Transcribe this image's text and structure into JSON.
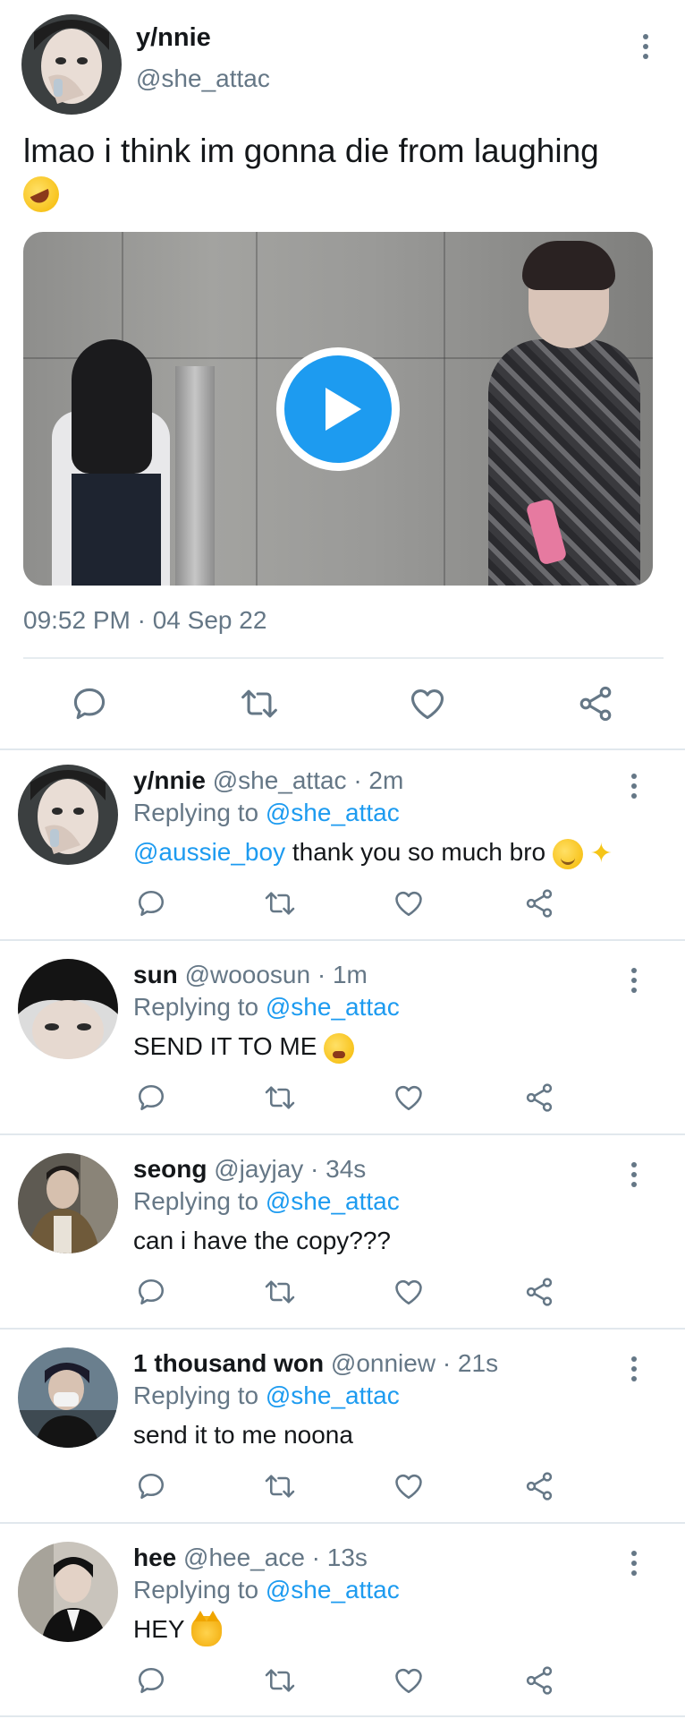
{
  "main_tweet": {
    "display_name": "y/nnie",
    "handle": "@she_attac",
    "text": "lmao i think im gonna die from laughing",
    "emoji": "rolling-on-floor-laughing",
    "timestamp": "09:52 PM · 04 Sep 22"
  },
  "colors": {
    "accent": "#1d9bf0",
    "secondary_text": "#657786",
    "divider": "#e1e8ed"
  },
  "replies": [
    {
      "display_name": "y/nnie",
      "meta": "@she_attac · 2m",
      "replying_prefix": "Replying to ",
      "replying_to": "@she_attac",
      "body_mention": "@aussie_boy",
      "body": "thank you so much bro",
      "emojis": [
        "relieved-face",
        "sparkles"
      ]
    },
    {
      "display_name": "sun",
      "meta": "@wooosun · 1m",
      "replying_prefix": "Replying to ",
      "replying_to": "@she_attac",
      "body": "SEND IT TO ME",
      "emojis": [
        "face-with-steam"
      ]
    },
    {
      "display_name": "seong",
      "meta": "@jayjay · 34s",
      "replying_prefix": "Replying to ",
      "replying_to": "@she_attac",
      "body": "can i have the copy???"
    },
    {
      "display_name": "1 thousand won",
      "meta": "@onniew · 21s",
      "replying_prefix": "Replying to ",
      "replying_to": "@she_attac",
      "body": "send it to me noona"
    },
    {
      "display_name": "hee",
      "meta": "@hee_ace · 13s",
      "replying_prefix": "Replying to ",
      "replying_to": "@she_attac",
      "body": "HEY",
      "emojis": [
        "pouting-cat"
      ]
    }
  ]
}
